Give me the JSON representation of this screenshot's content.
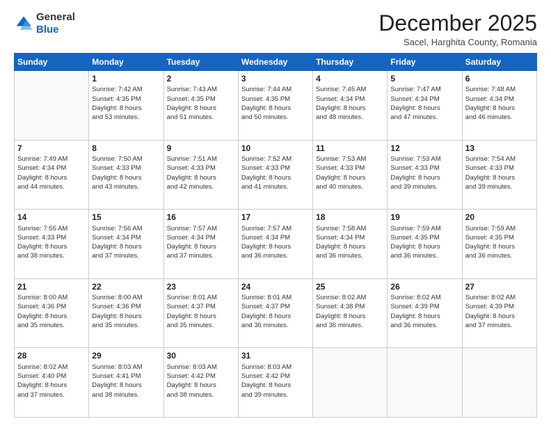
{
  "logo": {
    "general": "General",
    "blue": "Blue"
  },
  "title": "December 2025",
  "location": "Sacel, Harghita County, Romania",
  "days_header": [
    "Sunday",
    "Monday",
    "Tuesday",
    "Wednesday",
    "Thursday",
    "Friday",
    "Saturday"
  ],
  "weeks": [
    [
      {
        "num": "",
        "info": ""
      },
      {
        "num": "1",
        "info": "Sunrise: 7:42 AM\nSunset: 4:35 PM\nDaylight: 8 hours\nand 53 minutes."
      },
      {
        "num": "2",
        "info": "Sunrise: 7:43 AM\nSunset: 4:35 PM\nDaylight: 8 hours\nand 51 minutes."
      },
      {
        "num": "3",
        "info": "Sunrise: 7:44 AM\nSunset: 4:35 PM\nDaylight: 8 hours\nand 50 minutes."
      },
      {
        "num": "4",
        "info": "Sunrise: 7:45 AM\nSunset: 4:34 PM\nDaylight: 8 hours\nand 48 minutes."
      },
      {
        "num": "5",
        "info": "Sunrise: 7:47 AM\nSunset: 4:34 PM\nDaylight: 8 hours\nand 47 minutes."
      },
      {
        "num": "6",
        "info": "Sunrise: 7:48 AM\nSunset: 4:34 PM\nDaylight: 8 hours\nand 46 minutes."
      }
    ],
    [
      {
        "num": "7",
        "info": "Sunrise: 7:49 AM\nSunset: 4:34 PM\nDaylight: 8 hours\nand 44 minutes."
      },
      {
        "num": "8",
        "info": "Sunrise: 7:50 AM\nSunset: 4:33 PM\nDaylight: 8 hours\nand 43 minutes."
      },
      {
        "num": "9",
        "info": "Sunrise: 7:51 AM\nSunset: 4:33 PM\nDaylight: 8 hours\nand 42 minutes."
      },
      {
        "num": "10",
        "info": "Sunrise: 7:52 AM\nSunset: 4:33 PM\nDaylight: 8 hours\nand 41 minutes."
      },
      {
        "num": "11",
        "info": "Sunrise: 7:53 AM\nSunset: 4:33 PM\nDaylight: 8 hours\nand 40 minutes."
      },
      {
        "num": "12",
        "info": "Sunrise: 7:53 AM\nSunset: 4:33 PM\nDaylight: 8 hours\nand 39 minutes."
      },
      {
        "num": "13",
        "info": "Sunrise: 7:54 AM\nSunset: 4:33 PM\nDaylight: 8 hours\nand 39 minutes."
      }
    ],
    [
      {
        "num": "14",
        "info": "Sunrise: 7:55 AM\nSunset: 4:33 PM\nDaylight: 8 hours\nand 38 minutes."
      },
      {
        "num": "15",
        "info": "Sunrise: 7:56 AM\nSunset: 4:34 PM\nDaylight: 8 hours\nand 37 minutes."
      },
      {
        "num": "16",
        "info": "Sunrise: 7:57 AM\nSunset: 4:34 PM\nDaylight: 8 hours\nand 37 minutes."
      },
      {
        "num": "17",
        "info": "Sunrise: 7:57 AM\nSunset: 4:34 PM\nDaylight: 8 hours\nand 36 minutes."
      },
      {
        "num": "18",
        "info": "Sunrise: 7:58 AM\nSunset: 4:34 PM\nDaylight: 8 hours\nand 36 minutes."
      },
      {
        "num": "19",
        "info": "Sunrise: 7:59 AM\nSunset: 4:35 PM\nDaylight: 8 hours\nand 36 minutes."
      },
      {
        "num": "20",
        "info": "Sunrise: 7:59 AM\nSunset: 4:35 PM\nDaylight: 8 hours\nand 36 minutes."
      }
    ],
    [
      {
        "num": "21",
        "info": "Sunrise: 8:00 AM\nSunset: 4:36 PM\nDaylight: 8 hours\nand 35 minutes."
      },
      {
        "num": "22",
        "info": "Sunrise: 8:00 AM\nSunset: 4:36 PM\nDaylight: 8 hours\nand 35 minutes."
      },
      {
        "num": "23",
        "info": "Sunrise: 8:01 AM\nSunset: 4:37 PM\nDaylight: 8 hours\nand 35 minutes."
      },
      {
        "num": "24",
        "info": "Sunrise: 8:01 AM\nSunset: 4:37 PM\nDaylight: 8 hours\nand 36 minutes."
      },
      {
        "num": "25",
        "info": "Sunrise: 8:02 AM\nSunset: 4:38 PM\nDaylight: 8 hours\nand 36 minutes."
      },
      {
        "num": "26",
        "info": "Sunrise: 8:02 AM\nSunset: 4:39 PM\nDaylight: 8 hours\nand 36 minutes."
      },
      {
        "num": "27",
        "info": "Sunrise: 8:02 AM\nSunset: 4:39 PM\nDaylight: 8 hours\nand 37 minutes."
      }
    ],
    [
      {
        "num": "28",
        "info": "Sunrise: 8:02 AM\nSunset: 4:40 PM\nDaylight: 8 hours\nand 37 minutes."
      },
      {
        "num": "29",
        "info": "Sunrise: 8:03 AM\nSunset: 4:41 PM\nDaylight: 8 hours\nand 38 minutes."
      },
      {
        "num": "30",
        "info": "Sunrise: 8:03 AM\nSunset: 4:42 PM\nDaylight: 8 hours\nand 38 minutes."
      },
      {
        "num": "31",
        "info": "Sunrise: 8:03 AM\nSunset: 4:42 PM\nDaylight: 8 hours\nand 39 minutes."
      },
      {
        "num": "",
        "info": ""
      },
      {
        "num": "",
        "info": ""
      },
      {
        "num": "",
        "info": ""
      }
    ]
  ]
}
